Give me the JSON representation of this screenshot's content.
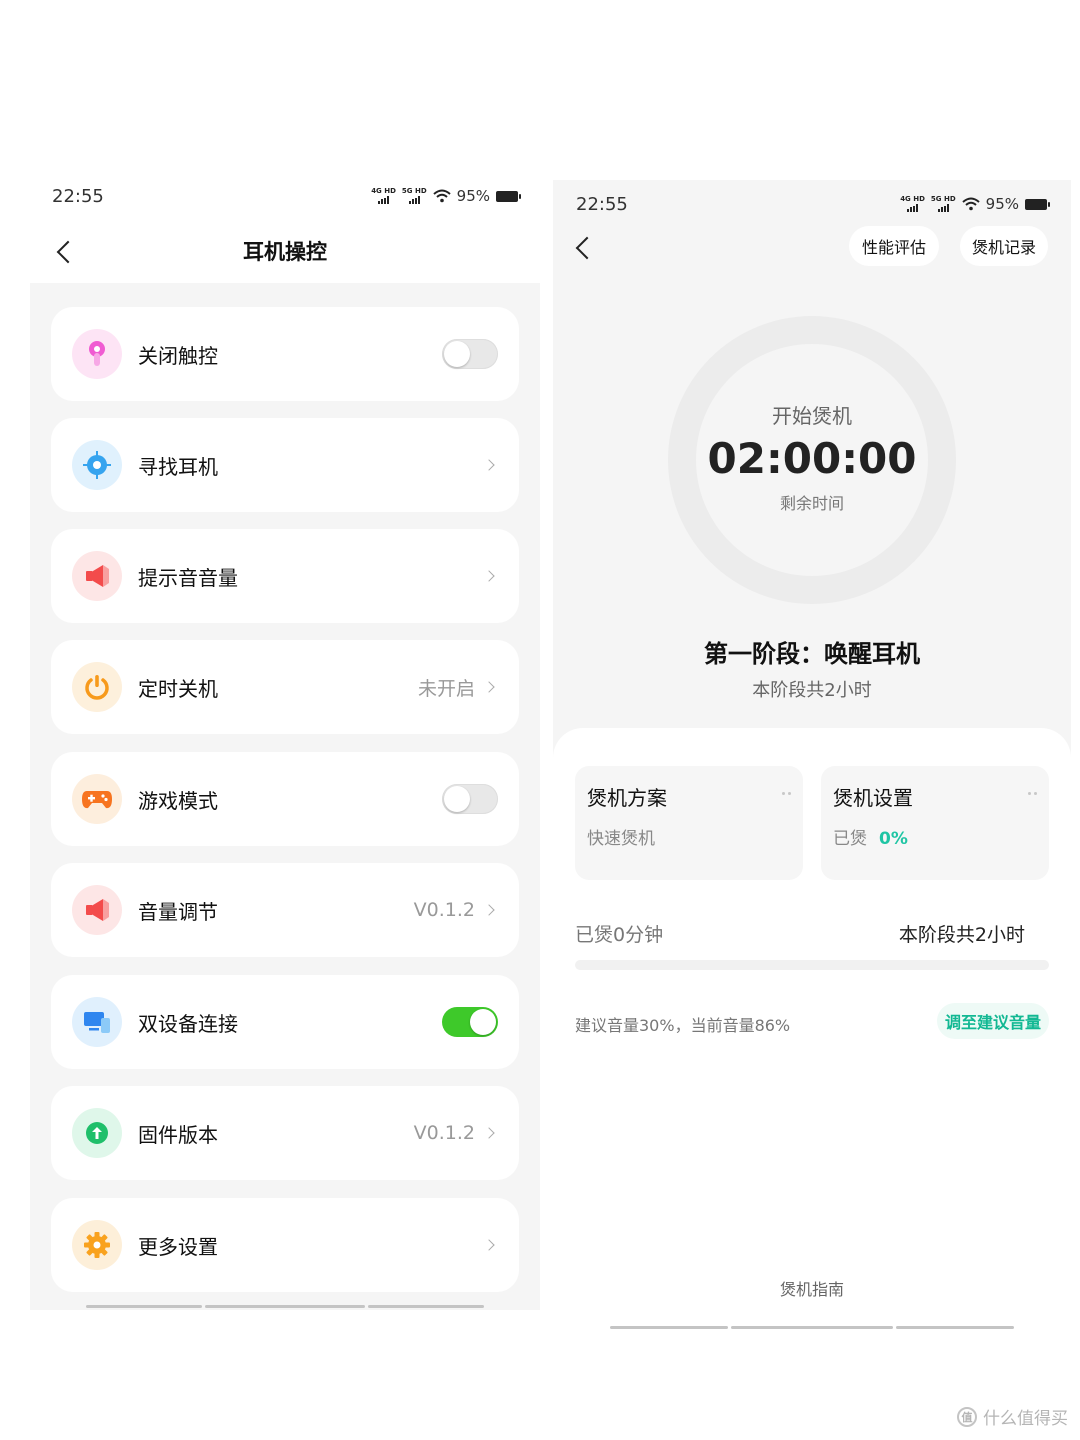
{
  "left": {
    "status": {
      "time": "22:55",
      "sig1": "4G HD",
      "sig2": "5G HD",
      "battery": "95%"
    },
    "title": "耳机操控",
    "items": [
      {
        "label": "关闭触控",
        "value": "",
        "control": "toggle",
        "on": false,
        "icon": "touch-icon"
      },
      {
        "label": "寻找耳机",
        "value": "",
        "control": "chevron",
        "icon": "locate-icon"
      },
      {
        "label": "提示音音量",
        "value": "",
        "control": "chevron",
        "icon": "speaker-icon"
      },
      {
        "label": "定时关机",
        "value": "未开启",
        "control": "chevron",
        "icon": "power-icon"
      },
      {
        "label": "游戏模式",
        "value": "",
        "control": "toggle",
        "on": false,
        "icon": "gamepad-icon"
      },
      {
        "label": "音量调节",
        "value": "V0.1.2",
        "control": "chevron",
        "icon": "speaker-icon"
      },
      {
        "label": "双设备连接",
        "value": "",
        "control": "toggle",
        "on": true,
        "icon": "devices-icon"
      },
      {
        "label": "固件版本",
        "value": "V0.1.2",
        "control": "chevron",
        "icon": "upgrade-icon"
      },
      {
        "label": "更多设置",
        "value": "",
        "control": "chevron",
        "icon": "gear-icon"
      }
    ]
  },
  "right": {
    "status": {
      "time": "22:55",
      "sig1": "4G HD",
      "sig2": "5G HD",
      "battery": "95%"
    },
    "header_buttons": {
      "evaluate": "性能评估",
      "records": "煲机记录"
    },
    "ring": {
      "start": "开始煲机",
      "timer": "02:00:00",
      "remaining": "剩余时间"
    },
    "stage": {
      "title": "第一阶段：唤醒耳机",
      "subtitle": "本阶段共2小时"
    },
    "plan_card": {
      "title": "煲机方案",
      "value": "快速煲机"
    },
    "settings_card": {
      "title": "煲机设置",
      "label": "已煲",
      "percent": "0%"
    },
    "progress": {
      "elapsed": "已煲0分钟",
      "total": "本阶段共2小时",
      "fraction": 0
    },
    "volume": {
      "hint": "建议音量30%，当前音量86%",
      "button": "调至建议音量"
    },
    "guide": "煲机指南"
  },
  "watermark": {
    "text": "什么值得买",
    "badge": "值"
  },
  "colors": {
    "accent_green": "#1fc5a4",
    "toggle_on": "#3ec92a",
    "background": "#f5f5f5"
  }
}
